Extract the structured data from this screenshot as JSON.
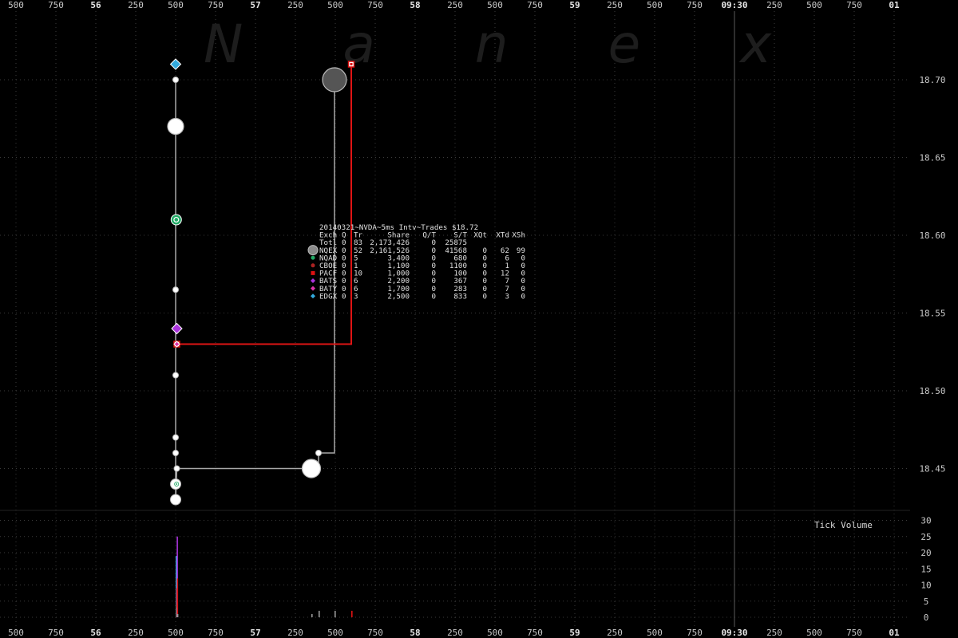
{
  "chart_data": {
    "type": "scatter",
    "watermark": "N a n e x",
    "x_ticks_top": [
      "500",
      "750",
      "56",
      "250",
      "500",
      "750",
      "57",
      "250",
      "500",
      "750",
      "58",
      "250",
      "500",
      "750",
      "59",
      "250",
      "500",
      "750",
      "09:30",
      "250",
      "500",
      "750",
      "01"
    ],
    "x_ticks_bottom": [
      "500",
      "750",
      "56",
      "250",
      "500",
      "750",
      "57",
      "250",
      "500",
      "750",
      "58",
      "250",
      "500",
      "750",
      "59",
      "250",
      "500",
      "750",
      "09:30",
      "250",
      "500",
      "750",
      "01"
    ],
    "bold_ticks": [
      "56",
      "57",
      "58",
      "59",
      "09:30",
      "01"
    ],
    "y_ticks": [
      "18.70",
      "18.65",
      "18.60",
      "18.55",
      "18.50",
      "18.45"
    ],
    "volume_ticks": [
      "30",
      "25",
      "20",
      "15",
      "10",
      "5",
      "0"
    ],
    "volume_label": "Tick Volume",
    "legend": {
      "title": "20140321~NVDA~5ms Intv~Trades $18.72",
      "columns": [
        "Exch",
        "Q",
        "Tr",
        "Share",
        "Q/T",
        "S/T",
        "XQt",
        "XTd",
        "XSh"
      ],
      "rows": [
        {
          "exch": "Totl",
          "q": "0",
          "tr": "83",
          "share": "2,173,426",
          "qt": "0",
          "st": "25875",
          "xqt": "",
          "xtd": "",
          "xsh": "",
          "color": "",
          "marker": "none"
        },
        {
          "exch": "NQEX",
          "q": "0",
          "tr": "52",
          "share": "2,161,526",
          "qt": "0",
          "st": "41568",
          "xqt": "0",
          "xtd": "62",
          "xsh": "99",
          "color": "#9a9a9a",
          "marker": "big-circle"
        },
        {
          "exch": "NQAD",
          "q": "0",
          "tr": "5",
          "share": "3,400",
          "qt": "0",
          "st": "680",
          "xqt": "0",
          "xtd": "6",
          "xsh": "0",
          "color": "#22aa66",
          "marker": "circle"
        },
        {
          "exch": "CBOE",
          "q": "0",
          "tr": "1",
          "share": "1,100",
          "qt": "0",
          "st": "1100",
          "xqt": "0",
          "xtd": "1",
          "xsh": "0",
          "color": "#aa2222",
          "marker": "circle"
        },
        {
          "exch": "PACF",
          "q": "0",
          "tr": "10",
          "share": "1,000",
          "qt": "0",
          "st": "100",
          "xqt": "0",
          "xtd": "12",
          "xsh": "0",
          "color": "#dd1111",
          "marker": "square"
        },
        {
          "exch": "BATS",
          "q": "0",
          "tr": "6",
          "share": "2,200",
          "qt": "0",
          "st": "367",
          "xqt": "0",
          "xtd": "7",
          "xsh": "0",
          "color": "#aa33dd",
          "marker": "diamond"
        },
        {
          "exch": "BATY",
          "q": "0",
          "tr": "6",
          "share": "1,700",
          "qt": "0",
          "st": "283",
          "xqt": "0",
          "xtd": "7",
          "xsh": "0",
          "color": "#dd33aa",
          "marker": "diamond"
        },
        {
          "exch": "EDGX",
          "q": "0",
          "tr": "3",
          "share": "2,500",
          "qt": "0",
          "st": "833",
          "xqt": "0",
          "xtd": "3",
          "xsh": "0",
          "color": "#33aadd",
          "marker": "diamond"
        }
      ]
    },
    "ylim": [
      18.425,
      18.725
    ],
    "volume_ylim": [
      0,
      30
    ],
    "x_tick_units": "ms",
    "series": [
      {
        "name": "NQEX",
        "color": "#d8d8d8",
        "marker": "circle",
        "points": [
          {
            "x": 0,
            "y": 18.7,
            "r": "s"
          },
          {
            "x": 0,
            "y": 18.67,
            "r": "l"
          },
          {
            "x": 0,
            "y": 18.565,
            "r": "s"
          },
          {
            "x": 0,
            "y": 18.51,
            "r": "s"
          },
          {
            "x": 0,
            "y": 18.47,
            "r": "s"
          },
          {
            "x": 0,
            "y": 18.46,
            "r": "s"
          },
          {
            "x": 0,
            "y": 18.44,
            "r": "m"
          },
          {
            "x": 0,
            "y": 18.43,
            "r": "m"
          },
          {
            "x": 15,
            "y": 18.45,
            "r": "s"
          },
          {
            "x": 1700,
            "y": 18.45,
            "r": "xl"
          },
          {
            "x": 1790,
            "y": 18.46,
            "r": "s"
          },
          {
            "x": 1990,
            "y": 18.7,
            "r": "xxl"
          }
        ],
        "path": [
          [
            0,
            18.7
          ],
          [
            0,
            18.43
          ],
          [
            15,
            18.45
          ],
          [
            1790,
            18.45
          ],
          [
            1790,
            18.46
          ],
          [
            1990,
            18.46
          ],
          [
            1990,
            18.7
          ]
        ]
      },
      {
        "name": "PACF",
        "color": "#dd1111",
        "marker": "square",
        "points": [
          {
            "x": 15,
            "y": 18.53,
            "r": "s"
          },
          {
            "x": 2200,
            "y": 18.71,
            "r": "s"
          }
        ],
        "path": [
          [
            15,
            18.53
          ],
          [
            2200,
            18.53
          ],
          [
            2200,
            18.71
          ]
        ]
      },
      {
        "name": "NQAD",
        "color": "#22aa66",
        "marker": "circle",
        "points": [
          {
            "x": 8,
            "y": 18.61,
            "r": "m"
          },
          {
            "x": 12,
            "y": 18.44,
            "r": "s"
          }
        ],
        "path": []
      },
      {
        "name": "BATS",
        "color": "#aa33dd",
        "marker": "diamond",
        "points": [
          {
            "x": 15,
            "y": 18.54,
            "r": "m"
          }
        ],
        "path": []
      },
      {
        "name": "BATY",
        "color": "#dd33aa",
        "marker": "diamond",
        "points": [
          {
            "x": 15,
            "y": 18.53,
            "r": "s"
          }
        ],
        "path": []
      },
      {
        "name": "EDGX",
        "color": "#33aadd",
        "marker": "diamond",
        "points": [
          {
            "x": 0,
            "y": 18.71,
            "r": "m"
          }
        ],
        "path": []
      }
    ],
    "volume_bars": [
      {
        "x": 0,
        "v": 19,
        "color": "#33aadd"
      },
      {
        "x": 3,
        "v": 4,
        "color": "#22aa66"
      },
      {
        "x": 6,
        "v": 9,
        "color": "#aa2222"
      },
      {
        "x": 10,
        "v": 3,
        "color": "#9a9a9a"
      },
      {
        "x": 13,
        "v": 25,
        "color": "#aa33dd"
      },
      {
        "x": 15,
        "v": 12,
        "color": "#dd1111"
      },
      {
        "x": 18,
        "v": 1,
        "color": "#9a9a9a"
      },
      {
        "x": 1700,
        "v": 1,
        "color": "#9a9a9a"
      },
      {
        "x": 1790,
        "v": 2,
        "color": "#9a9a9a"
      },
      {
        "x": 1990,
        "v": 2,
        "color": "#9a9a9a"
      },
      {
        "x": 2200,
        "v": 2,
        "color": "#dd1111"
      }
    ]
  }
}
